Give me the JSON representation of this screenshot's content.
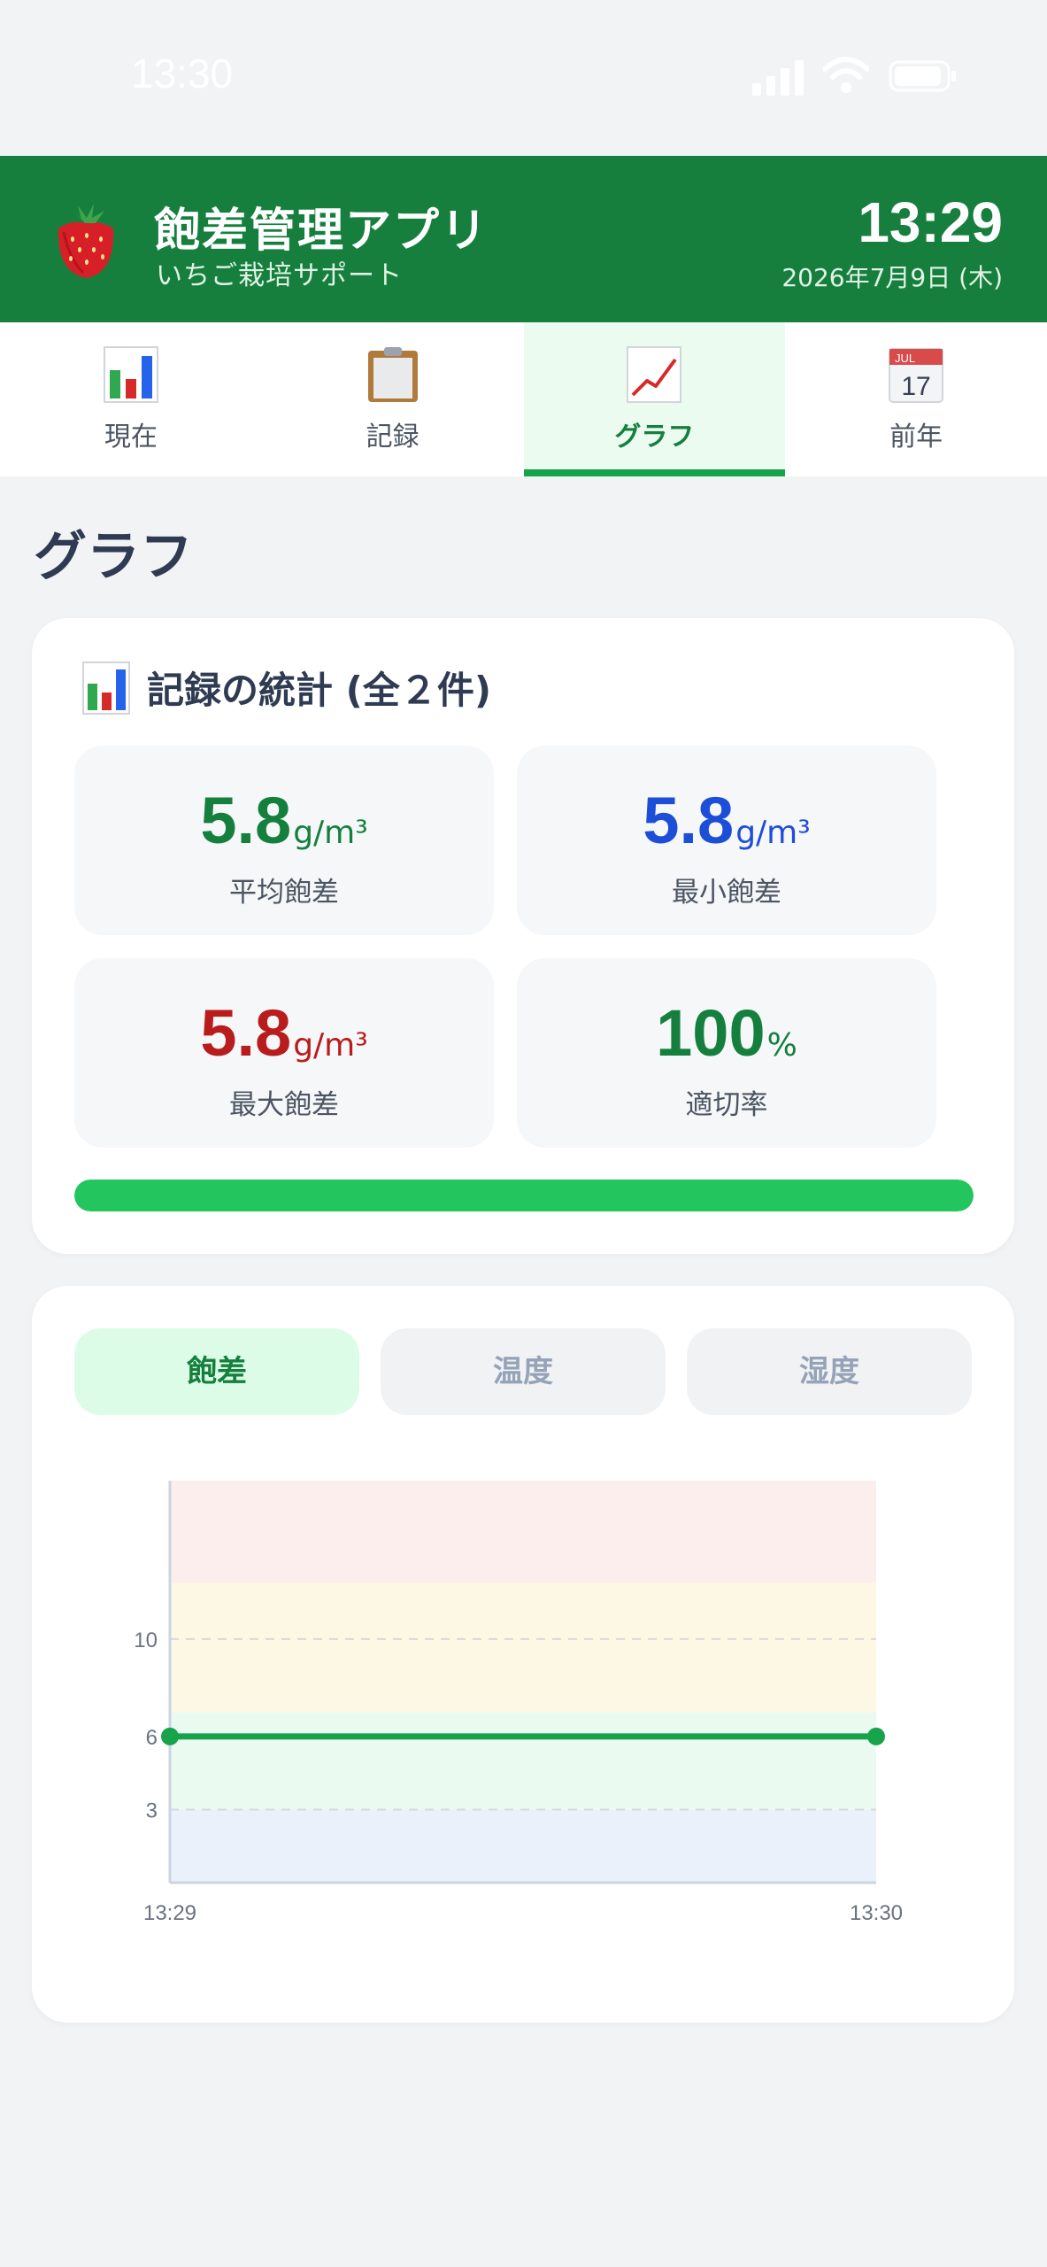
{
  "status_bar": {
    "time": "13:30",
    "signal_icon": "cellular-signal-icon",
    "wifi_icon": "wifi-icon",
    "battery_icon": "battery-icon"
  },
  "header": {
    "logo_icon": "strawberry-icon",
    "title": "飽差管理アプリ",
    "subtitle": "いちご栽培サポート",
    "clock": "13:29",
    "date": "2026年7月9日 (木)",
    "color": "#177f3d"
  },
  "tabs": [
    {
      "label": "現在",
      "icon": "bar-chart-icon",
      "active": false
    },
    {
      "label": "記録",
      "icon": "clipboard-icon",
      "active": false
    },
    {
      "label": "グラフ",
      "icon": "line-chart-icon",
      "active": true
    },
    {
      "label": "前年",
      "icon": "calendar-icon",
      "active": false,
      "icon_month": "JUL",
      "icon_day": "17"
    }
  ],
  "page_title": "グラフ",
  "stats": {
    "heading": "記録の統計 (全２件)",
    "heading_icon": "bar-chart-icon",
    "avg": {
      "value": "5.8",
      "unit": "g/m³",
      "label": "平均飽差",
      "color": "#15803d"
    },
    "min": {
      "value": "5.8",
      "unit": "g/m³",
      "label": "最小飽差",
      "color": "#1d4ed8"
    },
    "max": {
      "value": "5.8",
      "unit": "g/m³",
      "label": "最大飽差",
      "color": "#b91c1c"
    },
    "rate": {
      "value": "100",
      "unit": "%",
      "label": "適切率",
      "color": "#15803d"
    },
    "appropriate_rate_percent": 100
  },
  "chart_tabs": [
    {
      "label": "飽差",
      "active": true
    },
    {
      "label": "温度",
      "active": false
    },
    {
      "label": "湿度",
      "active": false
    }
  ],
  "chart_data": {
    "type": "line",
    "x": [
      "13:29",
      "13:30"
    ],
    "series": [
      {
        "values": [
          6,
          6
        ],
        "color": "#16a34a"
      }
    ],
    "y_ticks": [
      3,
      6,
      10
    ],
    "ylim": [
      0,
      16.5
    ],
    "bands": [
      {
        "from": 0,
        "to": 3,
        "color": "#eaf1fb"
      },
      {
        "from": 3,
        "to": 7,
        "color": "#eafaf0"
      },
      {
        "from": 7,
        "to": 12.3,
        "color": "#fdf8e3"
      },
      {
        "from": 12.3,
        "to": 16.5,
        "color": "#fdeeee"
      }
    ],
    "grid": "dashed horizontal at tick values",
    "title": "",
    "xlabel": "",
    "ylabel": ""
  }
}
